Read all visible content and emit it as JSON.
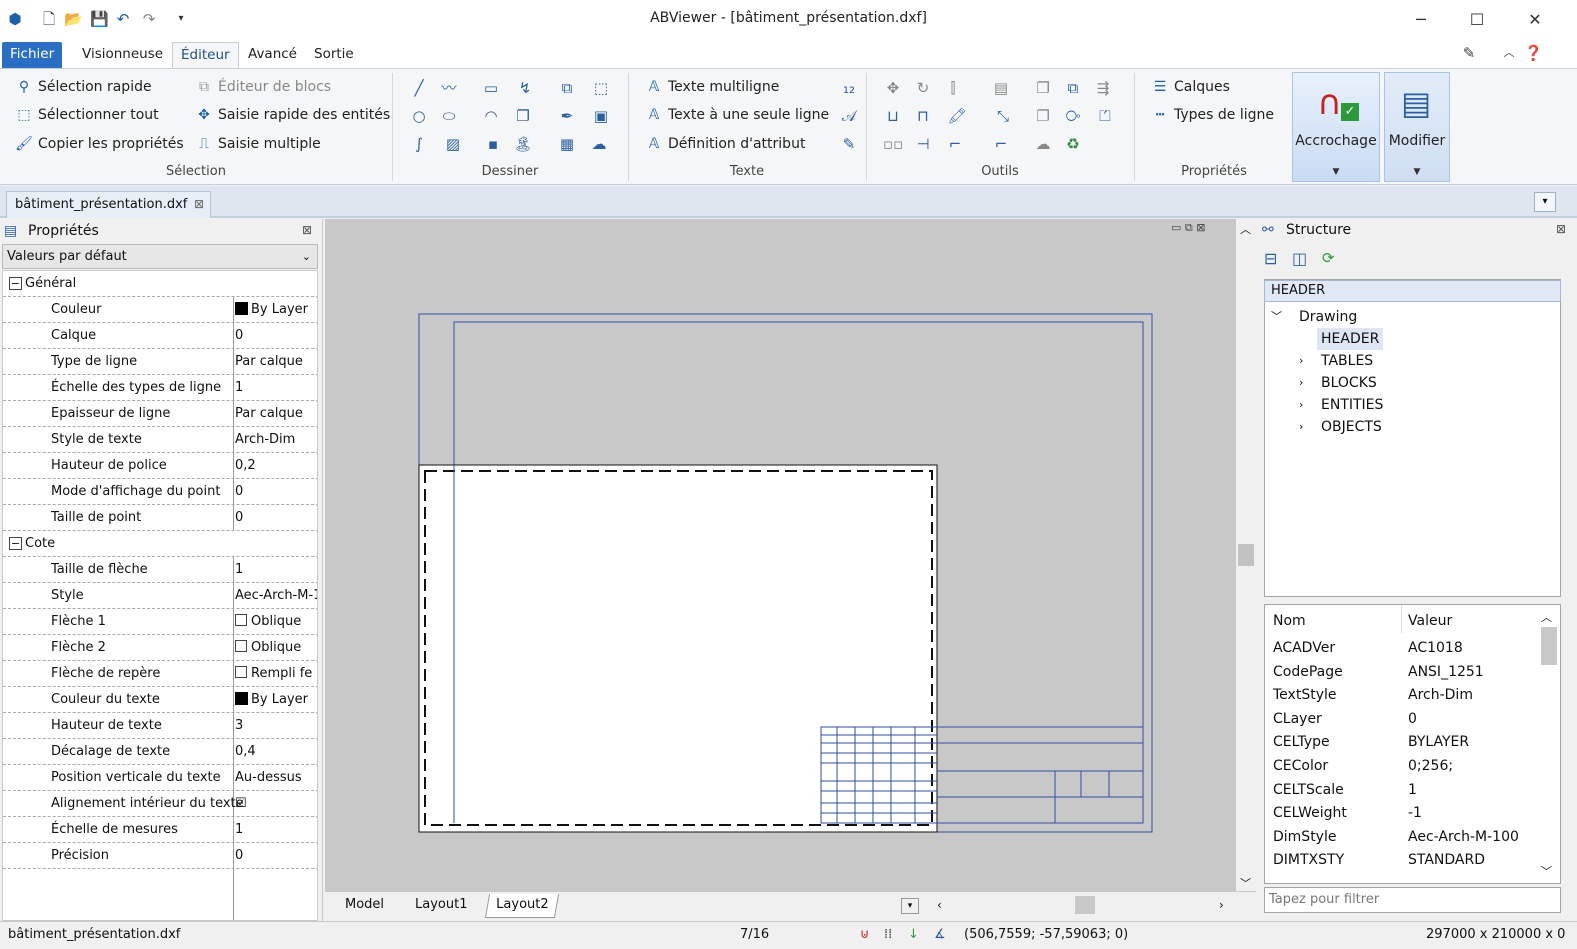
{
  "window": {
    "title": "ABViewer  - [bâtiment_présentation.dxf]"
  },
  "ribbon_tabs": [
    "Fichier",
    "Visionneuse",
    "Éditeur",
    "Avancé",
    "Sortie"
  ],
  "ribbon": {
    "selection": {
      "items": [
        "Sélection rapide",
        "Sélectionner tout",
        "Copier les propriétés",
        "Éditeur de blocs",
        "Saisie rapide des entités",
        "Saisie multiple"
      ],
      "label": "Sélection"
    },
    "draw": {
      "label": "Dessiner"
    },
    "text": {
      "items": [
        "Texte multiligne",
        "Texte à une seule ligne",
        "Définition d'attribut"
      ],
      "label": "Texte"
    },
    "tools": {
      "label": "Outils"
    },
    "properties": {
      "items": [
        "Calques",
        "Types de ligne"
      ],
      "label": "Propriétés"
    },
    "big": [
      "Accrochage",
      "Modifier"
    ]
  },
  "doc_tab": "bâtiment_présentation.dxf",
  "properties_panel": {
    "title": "Propriétés",
    "selector": "Valeurs par défaut",
    "general_label": "Général",
    "general": [
      {
        "k": "Couleur",
        "v": "By Layer"
      },
      {
        "k": "Calque",
        "v": "0"
      },
      {
        "k": "Type de ligne",
        "v": "Par calque"
      },
      {
        "k": "Échelle des types de ligne",
        "v": "1"
      },
      {
        "k": "Epaisseur de ligne",
        "v": "Par calque"
      },
      {
        "k": "Style de texte",
        "v": "Arch-Dim"
      },
      {
        "k": "Hauteur de police",
        "v": "0,2"
      },
      {
        "k": "Mode d'affichage du point",
        "v": "0"
      },
      {
        "k": "Taille de point",
        "v": "0"
      }
    ],
    "cote_label": "Cote",
    "cote": [
      {
        "k": "Taille de flèche",
        "v": "1"
      },
      {
        "k": "Style",
        "v": "Aec-Arch-M-1"
      },
      {
        "k": "Flèche 1",
        "v": "Oblique"
      },
      {
        "k": "Flèche 2",
        "v": "Oblique"
      },
      {
        "k": "Flèche de repère",
        "v": "Rempli fe"
      },
      {
        "k": "Couleur du texte",
        "v": "By Layer"
      },
      {
        "k": "Hauteur de texte",
        "v": "3"
      },
      {
        "k": "Décalage de texte",
        "v": "0,4"
      },
      {
        "k": "Position verticale du texte",
        "v": "Au-dessus"
      },
      {
        "k": "Alignement intérieur du texte",
        "v": "☑"
      },
      {
        "k": "Échelle de mesures",
        "v": "1"
      },
      {
        "k": "Précision",
        "v": "0"
      }
    ]
  },
  "layout_tabs": [
    "Model",
    "Layout1",
    "Layout2"
  ],
  "structure": {
    "title": "Structure",
    "header": "HEADER",
    "tree_root": "Drawing",
    "tree_children": [
      "HEADER",
      "TABLES",
      "BLOCKS",
      "ENTITIES",
      "OBJECTS"
    ],
    "kv_head": {
      "a": "Nom",
      "b": "Valeur"
    },
    "kv": [
      {
        "a": "ACADVer",
        "b": "AC1018"
      },
      {
        "a": "CodePage",
        "b": "ANSI_1251"
      },
      {
        "a": "TextStyle",
        "b": "Arch-Dim"
      },
      {
        "a": "CLayer",
        "b": "0"
      },
      {
        "a": "CELType",
        "b": "BYLAYER"
      },
      {
        "a": "CEColor",
        "b": "0;256;"
      },
      {
        "a": "CELTScale",
        "b": "1"
      },
      {
        "a": "CELWeight",
        "b": "-1"
      },
      {
        "a": "DimStyle",
        "b": "Aec-Arch-M-100"
      },
      {
        "a": "DIMTXSTY",
        "b": "STANDARD"
      }
    ],
    "filter_placeholder": "Tapez pour filtrer"
  },
  "status": {
    "file": "bâtiment_présentation.dxf",
    "page": "7/16",
    "coords": "(506,7559; -57,59063; 0)",
    "size": "297000 x 210000 x 0"
  }
}
